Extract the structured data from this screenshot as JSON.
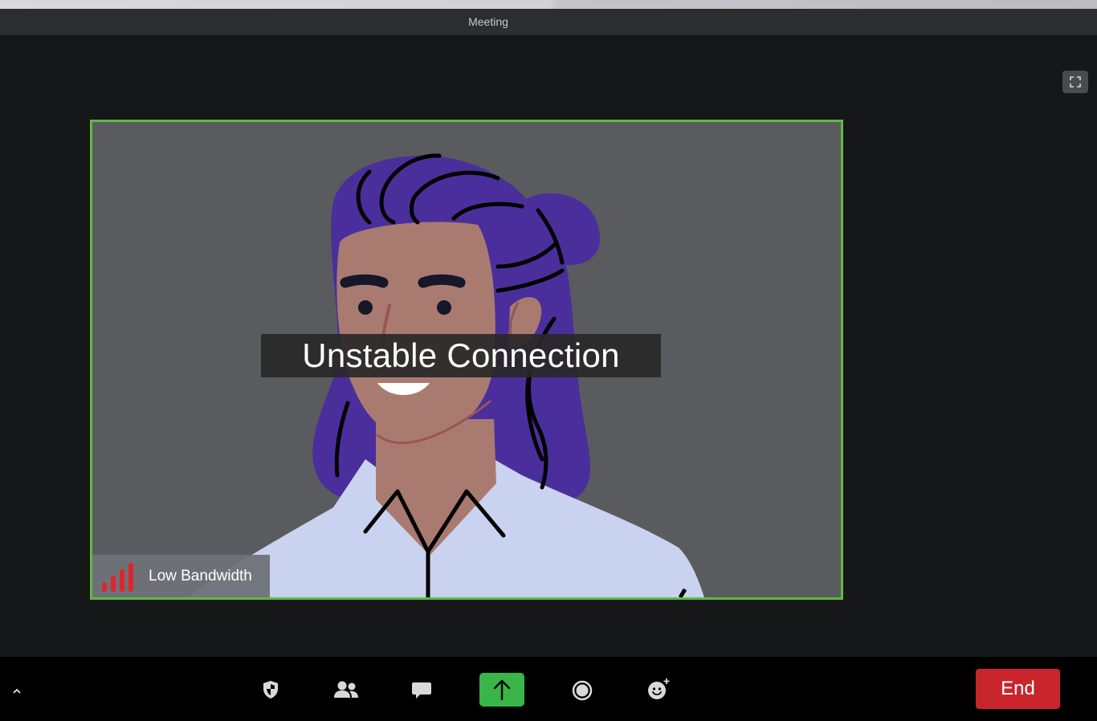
{
  "window": {
    "title": "Meeting"
  },
  "video": {
    "status_message": "Unstable Connection",
    "bandwidth_label": "Low Bandwidth",
    "bandwidth_bar_count": 4,
    "border_color": "#5dbb46"
  },
  "toolbar": {
    "expand_icon": "chevron-up-icon",
    "buttons": [
      {
        "icon": "security-shield-icon"
      },
      {
        "icon": "participants-icon"
      },
      {
        "icon": "chat-icon"
      },
      {
        "icon": "share-screen-arrow-icon",
        "color": "#39b54a"
      },
      {
        "icon": "record-icon"
      },
      {
        "icon": "reactions-icon"
      }
    ],
    "end_label": "End",
    "end_color": "#c9252c"
  },
  "colors": {
    "accent_green": "#39b54a",
    "danger_red": "#c9252c",
    "signal_red": "#e0242d"
  }
}
